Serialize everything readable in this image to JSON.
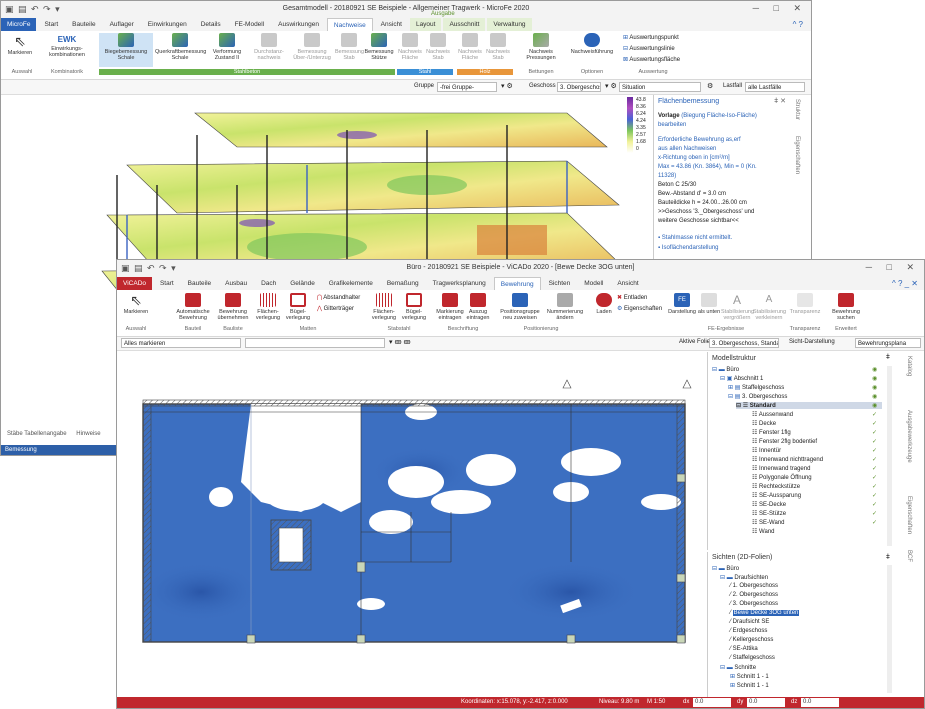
{
  "back_window": {
    "title": "Gesamtmodell - 20180921 SE Beispiele - Allgemeiner Tragwerk - MicroFe 2020",
    "context_tab_group": "Ausgabe",
    "tabs": [
      "MicroFe",
      "Start",
      "Bauteile",
      "Auflager",
      "Einwirkungen",
      "Details",
      "FE-Modell",
      "Auswirkungen",
      "Nachweise",
      "Ansicht",
      "Layout",
      "Ausschnitt",
      "Verwaltung"
    ],
    "active_tab": "Nachweise",
    "ribbon": {
      "markieren": "Markieren",
      "ewk": "EWK",
      "einwirkungskomb": "Einwirkungs-kombinationen",
      "biegebemessung": "Biegebemessung Schale",
      "querkraft": "Querkraftbemessung Schale",
      "verformung": "Verformung Zustand II",
      "durchstanz": "Durchstanz-nachweis",
      "bemessung_ober": "Bemessung Über-/Unterzug",
      "bemessung_stab": "Bemessung Stab",
      "bemessung_stuetze": "Bemessung Stütze",
      "nachweis_flaeche": "Nachweis Fläche",
      "nachweis_stab": "Nachweis Stab",
      "nachweis_flaeche2": "Nachweis Fläche",
      "nachweis_stab2": "Nachweis Stab",
      "nachweis_pressungen": "Nachweis Pressungen",
      "nachweisfuehrung": "Nachweisführung",
      "ausw_punkt": "Auswertungspunkt",
      "ausw_linie": "Auswertungslinie",
      "ausw_flaeche": "Auswertungsfläche"
    },
    "groups": {
      "auswahl": "Auswahl",
      "kombinatorik": "Kombinatorik",
      "stahlbeton": "Stahlbeton",
      "stahl": "Stahl",
      "holz": "Holz",
      "bettungen": "Bettungen",
      "optionen": "Optionen",
      "auswertung": "Auswertung"
    },
    "toolbar": {
      "gruppe_label": "Gruppe",
      "gruppe_value": "-frei Gruppe-",
      "geschoss_label": "Geschoss",
      "geschoss_value": "3. Obergeschoss",
      "situation": "Situation",
      "lastfall_label": "Lastfall",
      "lastfall_value": "alle Lastfälle"
    },
    "legend_values": [
      "43.8",
      "8.36",
      "6.24",
      "4.24",
      "3.35",
      "2.57",
      "1.68",
      "0"
    ],
    "info_panel": {
      "title": "Flächenbemessung",
      "vorlage_label": "Vorlage",
      "vorlage_value": "(Biegung Fläche-Iso-Fläche)",
      "bearbeiten": "bearbeiten",
      "lines": [
        "Erforderliche Bewehrung as,erf",
        "aus allen Nachweisen",
        "x-Richtung oben in [cm²/m]",
        "Max = 43.86 (Kn. 3864), Min = 0 (Kn.",
        "11328)",
        "Beton C 25/30",
        "Bew.-Abstand d' = 3.0 cm",
        "Bauteildicke h = 24.00...26.00 cm",
        ">>Geschoss '3._Obergeschoss' und",
        "weitere Geschosse sichtbar<<"
      ],
      "bullets": [
        "Stahlmasse nicht ermittelt.",
        "Isoflächendarstellung"
      ]
    },
    "right_side_tabs": [
      "Struktur",
      "Eigenschaften"
    ],
    "bottom_tabs": [
      "Stäbe Tabellenangabe",
      "Hinweise"
    ],
    "status": "Bemessung"
  },
  "front_window": {
    "title": "Büro - 20180921 SE Beispiele - ViCADo 2020 - [Bewe Decke 3OG unten]",
    "tabs": [
      "ViCADo",
      "Start",
      "Bauteile",
      "Ausbau",
      "Dach",
      "Gelände",
      "Grafikelemente",
      "Bemaßung",
      "Tragwerksplanung",
      "Bewehrung",
      "Sichten",
      "Modell",
      "Ansicht"
    ],
    "active_tab": "Bewehrung",
    "ribbon": {
      "markieren": "Markieren",
      "auto_bewehrung": "Automatische Bewehrung",
      "bewehrung_uebernehmen": "Bewehrung übernehmen",
      "flaechenverlegung": "Flächen-verlegung",
      "buegelverlegung": "Bügel-verlegung",
      "abstandhalter": "Abstandhalter",
      "gittertraeger": "Gitterträger",
      "flaechenverlegung2": "Flächen-verlegung",
      "buegelverlegung2": "Bügel-verlegung",
      "markierung": "Markierung eintragen",
      "auszug": "Auszug eintragen",
      "positionsgruppe": "Positionsgruppe neu zuweisen",
      "nummerierung": "Nummerierung ändern",
      "laden": "Laden",
      "entladen": "Entladen",
      "eigenschaften": "Eigenschaften",
      "darstellung": "Darstellung",
      "als_unten": "als unten",
      "stabilisierung": "Stabilisierung vergrößern",
      "stabilisierung2": "Stabilisierung verkleinern",
      "transparenz": "Transparenz",
      "bewehrung_suchen": "Bewehrung suchen"
    },
    "groups": {
      "auswahl": "Auswahl",
      "bauteil": "Bauteil",
      "bauliste": "Bauliste",
      "matten": "Matten",
      "stabstahl": "Stabstahl",
      "beschriftung": "Beschriftung",
      "positionierung": "Positionierung",
      "fe_ergebnisse": "FE-Ergebnisse",
      "transparenz": "Transparenz",
      "erweitert": "Erweitert"
    },
    "toolbar": {
      "filter_value": "Alles markieren",
      "aktive_folie_label": "Aktive Folie",
      "aktive_folie_value": "3. Obergeschoss, Standard",
      "sicht_label": "Sicht-Darstellung",
      "sicht_value": "Bewehrungsplana"
    },
    "model_panel": {
      "title": "Modellstruktur",
      "items": [
        {
          "label": "Büro",
          "level": 0
        },
        {
          "label": "Abschnitt 1",
          "level": 1
        },
        {
          "label": "Staffelgeschoss",
          "level": 2
        },
        {
          "label": "3. Obergeschoss",
          "level": 2
        },
        {
          "label": "Standard",
          "level": 3
        },
        {
          "label": "Aussenwand",
          "level": 4
        },
        {
          "label": "Decke",
          "level": 4
        },
        {
          "label": "Fenster 1flg",
          "level": 4
        },
        {
          "label": "Fenster 2flg bodentief",
          "level": 4
        },
        {
          "label": "Innentür",
          "level": 4
        },
        {
          "label": "Innenwand nichttragend",
          "level": 4
        },
        {
          "label": "Innenwand tragend",
          "level": 4
        },
        {
          "label": "Polygonale Öffnung",
          "level": 4
        },
        {
          "label": "Rechteckstütze",
          "level": 4
        },
        {
          "label": "SE-Aussparung",
          "level": 4
        },
        {
          "label": "SE-Decke",
          "level": 4
        },
        {
          "label": "SE-Stütze",
          "level": 4
        },
        {
          "label": "SE-Wand",
          "level": 4
        },
        {
          "label": "Wand",
          "level": 4
        }
      ]
    },
    "views_panel": {
      "title": "Sichten (2D-Folien)",
      "items": [
        {
          "label": "Büro",
          "level": 0
        },
        {
          "label": "Draufsichten",
          "level": 1
        },
        {
          "label": "1. Obergeschoss",
          "level": 2
        },
        {
          "label": "2. Obergeschoss",
          "level": 2
        },
        {
          "label": "3. Obergeschoss",
          "level": 2
        },
        {
          "label": "Bewe Decke 3OG unten",
          "level": 2,
          "selected": true
        },
        {
          "label": "Draufsicht SE",
          "level": 2
        },
        {
          "label": "Erdgeschoss",
          "level": 2
        },
        {
          "label": "Kellergeschoss",
          "level": 2
        },
        {
          "label": "SE-Attika",
          "level": 2
        },
        {
          "label": "Staffelgeschoss",
          "level": 2
        },
        {
          "label": "Schnitte",
          "level": 1
        },
        {
          "label": "Schnitt 1 - 1",
          "level": 2
        },
        {
          "label": "Schnitt 1 - 1",
          "level": 2
        }
      ]
    },
    "right_side_tabs": [
      "Katalog",
      "Ausgabewerkzeuge",
      "Eigenschaften",
      "BCF"
    ],
    "status": {
      "coords": "Koordinaten: x:15.078, y:-2.417, z:0.000",
      "niveau": "Niveau: 9.80 m",
      "scale": "M 1:50",
      "dx": "0.0",
      "dy": "0.0",
      "dz": "0.0"
    }
  },
  "colors": {
    "file_tab_blue": "#2b63b7",
    "vicado_red": "#c0272d",
    "stahlbeton_green": "#6ab04c",
    "stahl_blue": "#3a8fd6",
    "holz_orange": "#e8963a",
    "plan_blue": "#3c6fc1",
    "status_blue": "#2d5fa8"
  }
}
